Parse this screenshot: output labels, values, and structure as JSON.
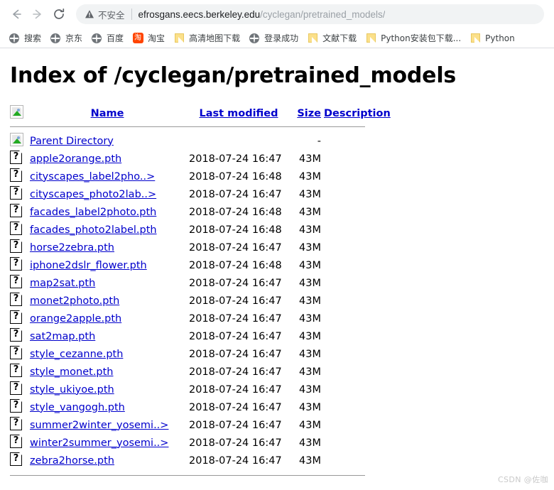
{
  "browser": {
    "back_label": "Back",
    "forward_label": "Forward",
    "reload_label": "Reload",
    "security_label": "不安全",
    "url_host": "efrosgans.eecs.berkeley.edu",
    "url_path": "/cyclegan/pretrained_models/",
    "bookmarks": [
      {
        "label": "搜索",
        "icon": "globe-icon"
      },
      {
        "label": "京东",
        "icon": "globe-icon"
      },
      {
        "label": "百度",
        "icon": "globe-icon"
      },
      {
        "label": "淘宝",
        "icon": "taobao-icon"
      },
      {
        "label": "高清地图下载",
        "icon": "folder-icon"
      },
      {
        "label": "登录成功",
        "icon": "globe-icon"
      },
      {
        "label": "文献下载",
        "icon": "folder-icon"
      },
      {
        "label": "Python安装包下载...",
        "icon": "folder-icon"
      },
      {
        "label": "Python",
        "icon": "folder-icon"
      }
    ]
  },
  "page": {
    "title": "Index of /cyclegan/pretrained_models",
    "columns": {
      "icon": "",
      "name": "Name",
      "last_modified": "Last modified",
      "size": "Size",
      "description": "Description"
    },
    "parent": {
      "name": "Parent Directory",
      "last_modified": "",
      "size": "-",
      "description": "",
      "icon": "broken-image-icon"
    },
    "files": [
      {
        "name": "apple2orange.pth",
        "last_modified": "2018-07-24 16:47",
        "size": "43M",
        "description": ""
      },
      {
        "name": "cityscapes_label2pho..>",
        "last_modified": "2018-07-24 16:48",
        "size": "43M",
        "description": ""
      },
      {
        "name": "cityscapes_photo2lab..>",
        "last_modified": "2018-07-24 16:47",
        "size": "43M",
        "description": ""
      },
      {
        "name": "facades_label2photo.pth",
        "last_modified": "2018-07-24 16:48",
        "size": "43M",
        "description": ""
      },
      {
        "name": "facades_photo2label.pth",
        "last_modified": "2018-07-24 16:48",
        "size": "43M",
        "description": ""
      },
      {
        "name": "horse2zebra.pth",
        "last_modified": "2018-07-24 16:47",
        "size": "43M",
        "description": ""
      },
      {
        "name": "iphone2dslr_flower.pth",
        "last_modified": "2018-07-24 16:48",
        "size": "43M",
        "description": ""
      },
      {
        "name": "map2sat.pth",
        "last_modified": "2018-07-24 16:47",
        "size": "43M",
        "description": ""
      },
      {
        "name": "monet2photo.pth",
        "last_modified": "2018-07-24 16:47",
        "size": "43M",
        "description": ""
      },
      {
        "name": "orange2apple.pth",
        "last_modified": "2018-07-24 16:47",
        "size": "43M",
        "description": ""
      },
      {
        "name": "sat2map.pth",
        "last_modified": "2018-07-24 16:47",
        "size": "43M",
        "description": ""
      },
      {
        "name": "style_cezanne.pth",
        "last_modified": "2018-07-24 16:47",
        "size": "43M",
        "description": ""
      },
      {
        "name": "style_monet.pth",
        "last_modified": "2018-07-24 16:47",
        "size": "43M",
        "description": ""
      },
      {
        "name": "style_ukiyoe.pth",
        "last_modified": "2018-07-24 16:47",
        "size": "43M",
        "description": ""
      },
      {
        "name": "style_vangogh.pth",
        "last_modified": "2018-07-24 16:47",
        "size": "43M",
        "description": ""
      },
      {
        "name": "summer2winter_yosemi..>",
        "last_modified": "2018-07-24 16:47",
        "size": "43M",
        "description": ""
      },
      {
        "name": "winter2summer_yosemi..>",
        "last_modified": "2018-07-24 16:47",
        "size": "43M",
        "description": ""
      },
      {
        "name": "zebra2horse.pth",
        "last_modified": "2018-07-24 16:47",
        "size": "43M",
        "description": ""
      }
    ]
  },
  "watermark": "CSDN @佐咖",
  "colors": {
    "link": "#0000cc",
    "omnibox_bg": "#f1f3f4",
    "url_host": "#202124",
    "url_path": "#9aa0a6",
    "rule": "#999999"
  }
}
